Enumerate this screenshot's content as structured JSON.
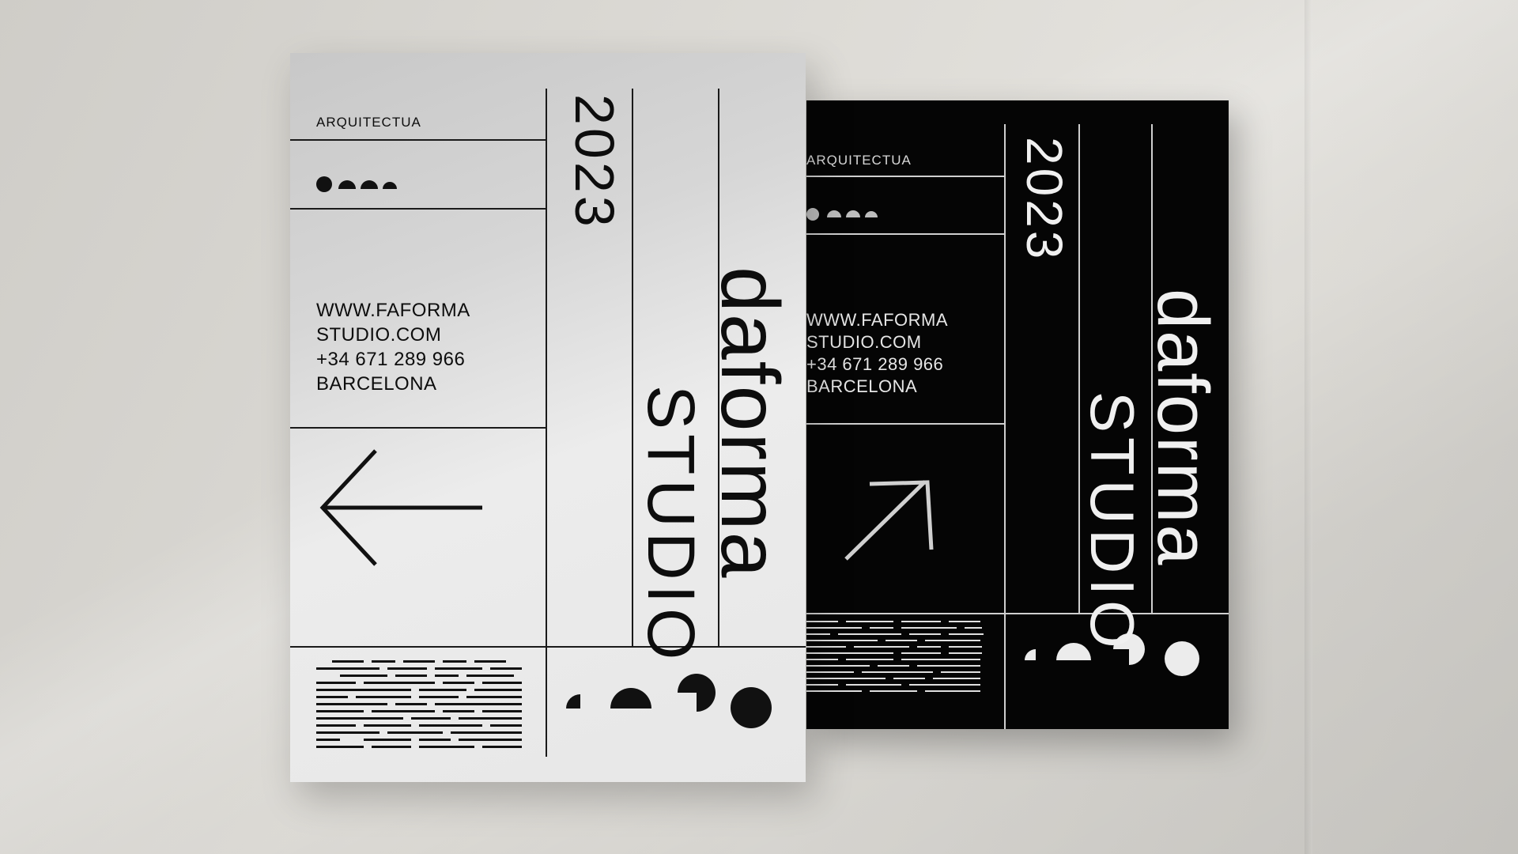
{
  "posters": {
    "light": {
      "category": "ARQUITECTUA",
      "year": "2023",
      "brand": "daforma",
      "studio": "STUDIO",
      "contact": [
        "WWW.FAFORMA",
        "STUDIO.COM",
        "+34 671 289 966",
        "BARCELONA"
      ],
      "arrow": "left-arrow-icon"
    },
    "dark": {
      "category": "ARQUITECTUA",
      "year": "2023",
      "brand": "daforma",
      "studio": "STUDIO",
      "contact": [
        "WWW.FAFORMA",
        "STUDIO.COM",
        "+34 671 289 966",
        "BARCELONA"
      ],
      "arrow": "up-right-arrow-icon"
    }
  },
  "colors": {
    "wall": "#d9d7d2",
    "light_poster": "#e6e6e6",
    "dark_poster": "#050505",
    "ink": "#0d0d0d"
  }
}
